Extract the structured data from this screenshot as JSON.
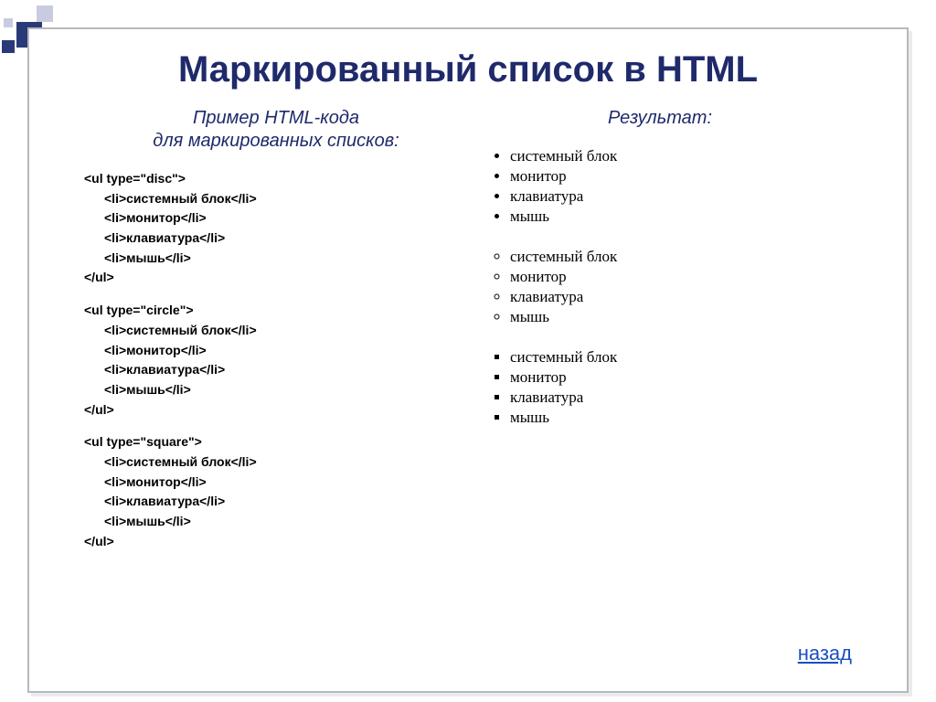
{
  "title": "Маркированный список в HTML",
  "left_header_line1": "Пример HTML-кода",
  "left_header_line2": "для маркированных списков:",
  "right_header": "Результат:",
  "code": {
    "blocks": [
      {
        "open": "<ul type=\"disc\">",
        "items": [
          "<li>системный блок</li>",
          "<li>монитор</li>",
          "<li>клавиатура</li>",
          "<li>мышь</li>"
        ],
        "close": "</ul>"
      },
      {
        "open": "<ul type=\"circle\">",
        "items": [
          "<li>системный блок</li>",
          "<li>монитор</li>",
          "<li>клавиатура</li>",
          "<li>мышь</li>"
        ],
        "close": "</ul>"
      },
      {
        "open": "<ul type=\"square\">",
        "items": [
          "<li>системный блок</li>",
          "<li>монитор</li>",
          "<li>клавиатура</li>",
          "<li>мышь</li>"
        ],
        "close": "</ul>"
      }
    ]
  },
  "result": {
    "lists": [
      {
        "type": "disc",
        "items": [
          "системный блок",
          "монитор",
          "клавиатура",
          "мышь"
        ]
      },
      {
        "type": "circle",
        "items": [
          "системный блок",
          "монитор",
          "клавиатура",
          "мышь"
        ]
      },
      {
        "type": "square",
        "items": [
          "системный блок",
          "монитор",
          "клавиатура",
          "мышь"
        ]
      }
    ]
  },
  "back_label": "назад"
}
